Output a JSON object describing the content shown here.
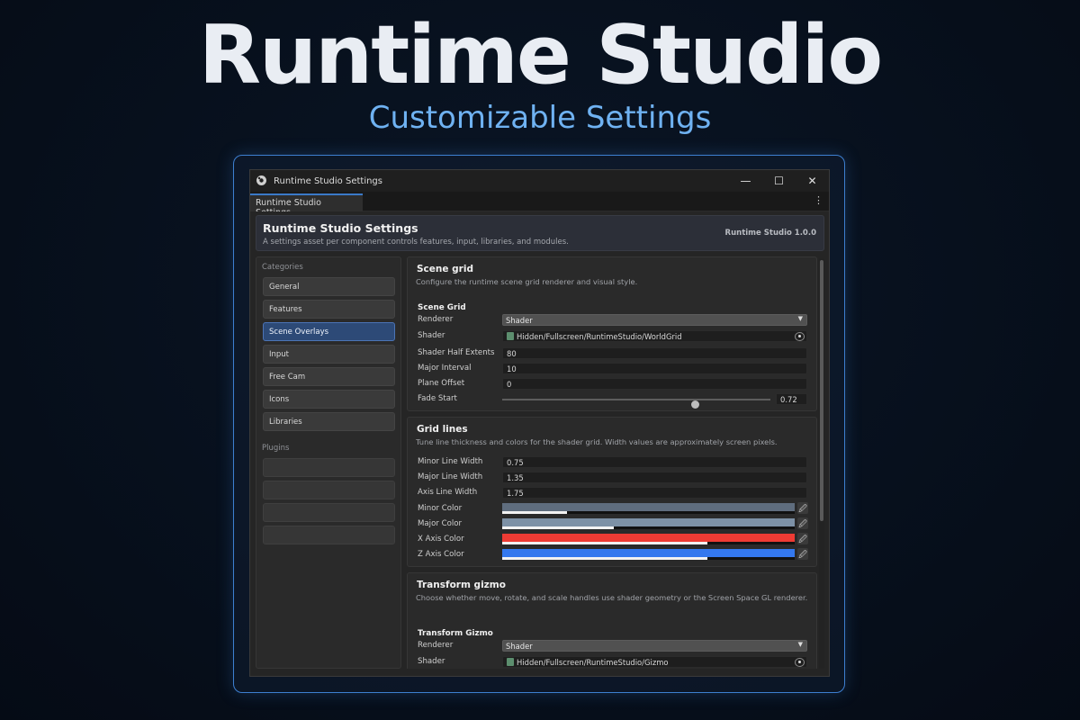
{
  "hero": {
    "title": "Runtime Studio",
    "subtitle": "Customizable Settings"
  },
  "window": {
    "title": "Runtime Studio Settings",
    "minimize": "—",
    "maximize": "☐",
    "close": "✕",
    "tab_label": "Runtime Studio Settings",
    "tab_menu": "⋮"
  },
  "header": {
    "title": "Runtime Studio Settings",
    "description": "A settings asset per component controls features, input, libraries, and modules.",
    "version": "Runtime Studio 1.0.0"
  },
  "sidebar": {
    "categories_label": "Categories",
    "items": [
      {
        "label": "General"
      },
      {
        "label": "Features"
      },
      {
        "label": "Scene Overlays",
        "active": true
      },
      {
        "label": "Input"
      },
      {
        "label": "Free Cam"
      },
      {
        "label": "Icons"
      },
      {
        "label": "Libraries"
      }
    ],
    "plugins_label": "Plugins"
  },
  "scene_grid": {
    "title": "Scene grid",
    "description": "Configure the runtime scene grid renderer and visual style.",
    "subheading": "Scene Grid",
    "renderer_label": "Renderer",
    "renderer_value": "Shader",
    "shader_label": "Shader",
    "shader_value": "Hidden/Fullscreen/RuntimeStudio/WorldGrid",
    "half_extents_label": "Shader Half Extents",
    "half_extents_value": "80",
    "major_interval_label": "Major Interval",
    "major_interval_value": "10",
    "plane_offset_label": "Plane Offset",
    "plane_offset_value": "0",
    "fade_start_label": "Fade Start",
    "fade_start_value": "0.72",
    "fade_start_fraction": 0.72
  },
  "grid_lines": {
    "title": "Grid lines",
    "description": "Tune line thickness and colors for the shader grid. Width values are approximately screen pixels.",
    "minor_width_label": "Minor Line Width",
    "minor_width_value": "0.75",
    "major_width_label": "Major Line Width",
    "major_width_value": "1.35",
    "axis_width_label": "Axis Line Width",
    "axis_width_value": "1.75",
    "colors": [
      {
        "label": "Minor Color",
        "color": "#5f6d7e",
        "alpha": 0.22
      },
      {
        "label": "Major Color",
        "color": "#7d91a6",
        "alpha": 0.38
      },
      {
        "label": "X Axis Color",
        "color": "#ee3b34",
        "alpha": 0.7
      },
      {
        "label": "Z Axis Color",
        "color": "#3478ee",
        "alpha": 0.7
      }
    ]
  },
  "transform_gizmo": {
    "title": "Transform gizmo",
    "description": "Choose whether move, rotate, and scale handles use shader geometry or the Screen Space GL renderer.",
    "subheading": "Transform Gizmo",
    "renderer_label": "Renderer",
    "renderer_value": "Shader",
    "shader_label": "Shader",
    "shader_value": "Hidden/Fullscreen/RuntimeStudio/Gizmo"
  },
  "icons": {
    "dropdown_arrow": "▼",
    "eyedropper": "🖉"
  }
}
